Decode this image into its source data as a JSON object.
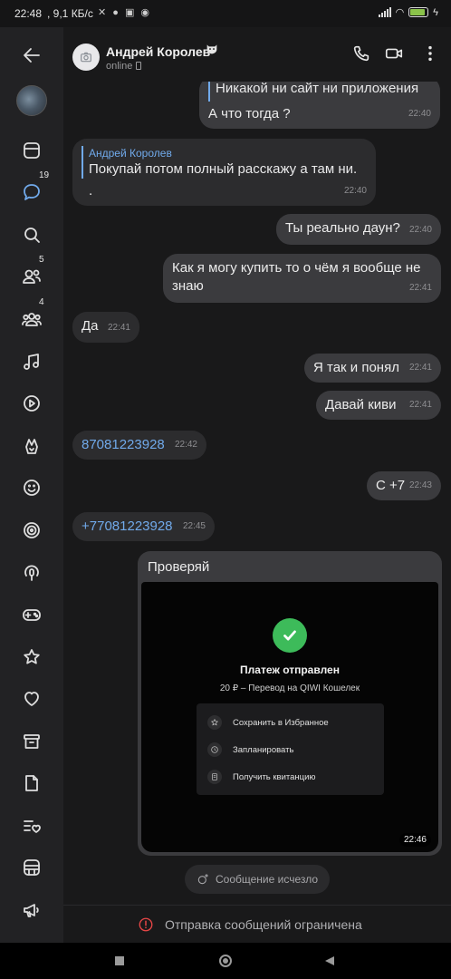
{
  "status_bar": {
    "time": "22:48",
    "network_speed": "9,1 КБ/с",
    "battery_level": 0.86
  },
  "sidebar": {
    "items": [
      {
        "name": "back",
        "icon": "back-arrow-icon"
      },
      {
        "name": "profile",
        "icon": "avatar"
      },
      {
        "name": "news",
        "icon": "news-icon"
      },
      {
        "name": "messages",
        "icon": "messages-icon",
        "badge": "19",
        "active": true
      },
      {
        "name": "search",
        "icon": "search-icon"
      },
      {
        "name": "friends",
        "icon": "friends-icon",
        "badge": "5"
      },
      {
        "name": "communities",
        "icon": "communities-icon",
        "badge": "4"
      },
      {
        "name": "music",
        "icon": "music-icon"
      },
      {
        "name": "video",
        "icon": "video-icon"
      },
      {
        "name": "clips",
        "icon": "clips-icon"
      },
      {
        "name": "stickers",
        "icon": "smile-icon"
      },
      {
        "name": "target",
        "icon": "target-icon"
      },
      {
        "name": "podcasts",
        "icon": "podcast-icon"
      },
      {
        "name": "games",
        "icon": "gamepad-icon"
      },
      {
        "name": "favorites",
        "icon": "star-icon"
      },
      {
        "name": "likes",
        "icon": "heart-icon"
      },
      {
        "name": "archive",
        "icon": "archive-icon"
      },
      {
        "name": "documents",
        "icon": "document-icon"
      },
      {
        "name": "lists",
        "icon": "list-heart-icon"
      },
      {
        "name": "services",
        "icon": "services-icon"
      },
      {
        "name": "ads",
        "icon": "megaphone-icon"
      }
    ]
  },
  "header": {
    "contact_name": "Андрей Королев",
    "status": "online"
  },
  "messages": [
    {
      "id": "m1",
      "direction": "out",
      "lines": [
        "Никакой ни сайт ни приложения",
        "А что тогда ?"
      ],
      "time": "22:40"
    },
    {
      "id": "m2",
      "direction": "in",
      "reply_author": "Андрей Королев",
      "reply_text": "Покупай потом полный расскажу а там ни...",
      "text": ".",
      "time": "22:40"
    },
    {
      "id": "m3",
      "direction": "out",
      "text": "Ты реально даун?",
      "time": "22:40"
    },
    {
      "id": "m4",
      "direction": "out",
      "lines": [
        "Как я могу купить то о чём я вообще не",
        "знаю"
      ],
      "time": "22:41"
    },
    {
      "id": "m5",
      "direction": "in",
      "text": "Да",
      "time": "22:41"
    },
    {
      "id": "m6",
      "direction": "out",
      "text": "Я так и понял",
      "time": "22:41"
    },
    {
      "id": "m7",
      "direction": "out",
      "text": "Давай киви",
      "time": "22:41"
    },
    {
      "id": "m8",
      "direction": "in",
      "text": "87081223928",
      "time": "22:42",
      "is_link": true
    },
    {
      "id": "m9",
      "direction": "out",
      "text": "С +7",
      "time": "22:43"
    },
    {
      "id": "m10",
      "direction": "in",
      "text": "+77081223928",
      "time": "22:45",
      "is_link": true
    }
  ],
  "photo_message": {
    "caption": "Проверяй",
    "time": "22:46",
    "screenshot": {
      "title": "Платеж отправлен",
      "subtitle": "20 ₽ – Перевод на QIWI Кошелек",
      "menu": [
        {
          "icon": "star-icon",
          "label": "Сохранить в Избранное"
        },
        {
          "icon": "clock-icon",
          "label": "Запланировать"
        },
        {
          "icon": "receipt-icon",
          "label": "Получить квитанцию"
        }
      ]
    }
  },
  "vanished_notice": "Сообщение исчезло",
  "restriction_notice": "Отправка сообщений ограничена",
  "colors": {
    "accent": "#71aaeb",
    "background": "#19191a",
    "bubble_in": "#2c2c2e",
    "bubble_out": "#3b3b3e",
    "success": "#3dbb5a",
    "warning": "#e64646"
  }
}
